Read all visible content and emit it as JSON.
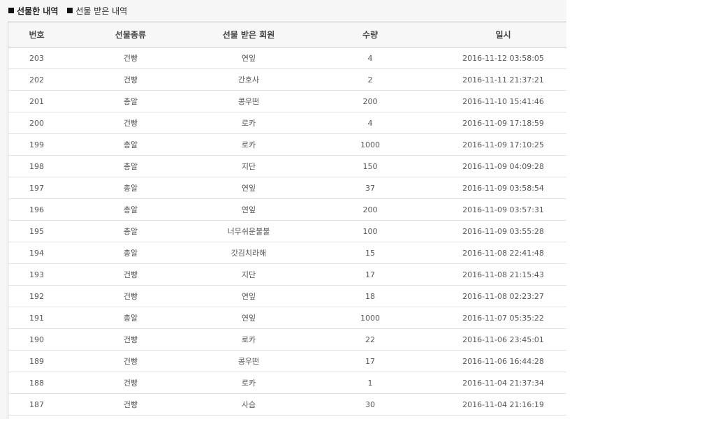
{
  "tabs": [
    {
      "label": "선물한 내역",
      "active": true
    },
    {
      "label": "선물 받은 내역",
      "active": false
    }
  ],
  "table": {
    "headers": {
      "no": "번호",
      "type": "선물종류",
      "member": "선물 받은 회원",
      "qty": "수량",
      "date": "일시"
    },
    "rows": [
      {
        "no": "203",
        "type": "건빵",
        "member": "연잎",
        "qty": "4",
        "date": "2016-11-12 03:58:05"
      },
      {
        "no": "202",
        "type": "건빵",
        "member": "간호사",
        "qty": "2",
        "date": "2016-11-11 21:37:21"
      },
      {
        "no": "201",
        "type": "총알",
        "member": "콩우떤",
        "qty": "200",
        "date": "2016-11-10 15:41:46"
      },
      {
        "no": "200",
        "type": "건빵",
        "member": "로카",
        "qty": "4",
        "date": "2016-11-09 17:18:59"
      },
      {
        "no": "199",
        "type": "총알",
        "member": "로카",
        "qty": "1000",
        "date": "2016-11-09 17:10:25"
      },
      {
        "no": "198",
        "type": "총알",
        "member": "지단",
        "qty": "150",
        "date": "2016-11-09 04:09:28"
      },
      {
        "no": "197",
        "type": "총알",
        "member": "연잎",
        "qty": "37",
        "date": "2016-11-09 03:58:54"
      },
      {
        "no": "196",
        "type": "총알",
        "member": "연잎",
        "qty": "200",
        "date": "2016-11-09 03:57:31"
      },
      {
        "no": "195",
        "type": "총알",
        "member": "너무쉬운불불",
        "qty": "100",
        "date": "2016-11-09 03:55:28"
      },
      {
        "no": "194",
        "type": "총알",
        "member": "갓김치라해",
        "qty": "15",
        "date": "2016-11-08 22:41:48"
      },
      {
        "no": "193",
        "type": "건빵",
        "member": "지단",
        "qty": "17",
        "date": "2016-11-08 21:15:43"
      },
      {
        "no": "192",
        "type": "건빵",
        "member": "연잎",
        "qty": "18",
        "date": "2016-11-08 02:23:27"
      },
      {
        "no": "191",
        "type": "총알",
        "member": "연잎",
        "qty": "1000",
        "date": "2016-11-07 05:35:22"
      },
      {
        "no": "190",
        "type": "건빵",
        "member": "로카",
        "qty": "22",
        "date": "2016-11-06 23:45:01"
      },
      {
        "no": "189",
        "type": "건빵",
        "member": "콩우떤",
        "qty": "17",
        "date": "2016-11-06 16:44:28"
      },
      {
        "no": "188",
        "type": "건빵",
        "member": "로카",
        "qty": "1",
        "date": "2016-11-04 21:37:34"
      },
      {
        "no": "187",
        "type": "건빵",
        "member": "사슴",
        "qty": "30",
        "date": "2016-11-04 21:16:19"
      }
    ]
  }
}
